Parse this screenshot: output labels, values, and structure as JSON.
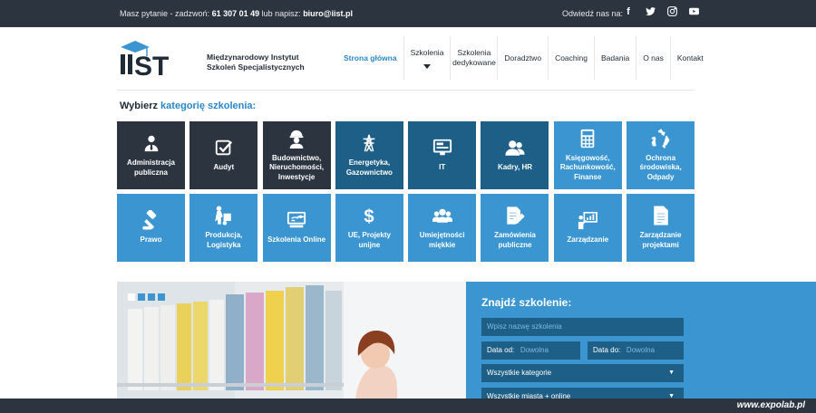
{
  "topbar": {
    "question": "Masz pytanie - zadzwoń:",
    "phone": "61 307 01 49",
    "or_write": "lub napisz:",
    "email": "biuro@iist.pl",
    "visit": "Odwiedź nas na:",
    "social": [
      {
        "icon": "facebook-icon",
        "glyph": "f"
      },
      {
        "icon": "twitter-icon",
        "glyph": "t"
      },
      {
        "icon": "instagram-icon",
        "glyph": "◎"
      },
      {
        "icon": "youtube-icon",
        "glyph": "▶"
      }
    ]
  },
  "logo": {
    "mark": "IIST",
    "line1": "Międzynarodowy Instytut",
    "line2": "Szkoleń Specjalistycznych"
  },
  "nav": [
    {
      "label": "Strona główna"
    },
    {
      "label": "Szkolenia"
    },
    {
      "label": "Szkolenia dedykowane"
    },
    {
      "label": "Doradztwo"
    },
    {
      "label": "Coaching"
    },
    {
      "label": "Badania"
    },
    {
      "label": "O nas"
    },
    {
      "label": "Kontakt"
    }
  ],
  "categories": {
    "title_prefix": "Wybierz",
    "title_highlight": "kategorię szkolenia:",
    "items": [
      {
        "label": "Administracja publiczna",
        "icon": "user-tie-icon",
        "color": "dark"
      },
      {
        "label": "Audyt",
        "icon": "checkbox-icon",
        "color": "dark"
      },
      {
        "label": "Budownictwo, Nieruchomości, Inwestycje",
        "icon": "worker-icon",
        "color": "dark"
      },
      {
        "label": "Energetyka, Gazownictwo",
        "icon": "power-tower-icon",
        "color": "navy"
      },
      {
        "label": "IT",
        "icon": "monitor-icon",
        "color": "navy"
      },
      {
        "label": "Kadry, HR",
        "icon": "users-icon",
        "color": "navy"
      },
      {
        "label": "Księgowość, Rachunkowość, Finanse",
        "icon": "calculator-icon",
        "color": "blue"
      },
      {
        "label": "Ochrona środowiska, Odpady",
        "icon": "recycle-icon",
        "color": "blue"
      },
      {
        "label": "Prawo",
        "icon": "gavel-icon",
        "color": "blue"
      },
      {
        "label": "Produkcja, Logistyka",
        "icon": "hand-truck-icon",
        "color": "blue"
      },
      {
        "label": "Szkolenia Online",
        "icon": "online-learning-icon",
        "color": "blue"
      },
      {
        "label": "UE, Projekty unijne",
        "icon": "dollar-icon",
        "color": "blue"
      },
      {
        "label": "Umiejętności miękkie",
        "icon": "group-icon",
        "color": "blue"
      },
      {
        "label": "Zamówienia publiczne",
        "icon": "document-pen-icon",
        "color": "blue"
      },
      {
        "label": "Zarządzanie",
        "icon": "presentation-icon",
        "color": "blue"
      },
      {
        "label": "Zarządzanie projektami",
        "icon": "file-list-icon",
        "color": "blue"
      }
    ]
  },
  "slider": {
    "dots": 4
  },
  "search": {
    "title": "Znajdź szkolenie:",
    "name_placeholder": "Wpisz nazwę szkolenia",
    "date_from_label": "Data od:",
    "date_from_placeholder": "Dowolna",
    "date_to_label": "Data do:",
    "date_to_placeholder": "Dowolna",
    "category": "Wszystkie kategorie",
    "city": "Wszystkie miasta + online"
  },
  "watermark": "www.expolab.pl",
  "colors": {
    "dark": "#2c3440",
    "navy": "#1d5f86",
    "blue": "#3a95d1"
  }
}
